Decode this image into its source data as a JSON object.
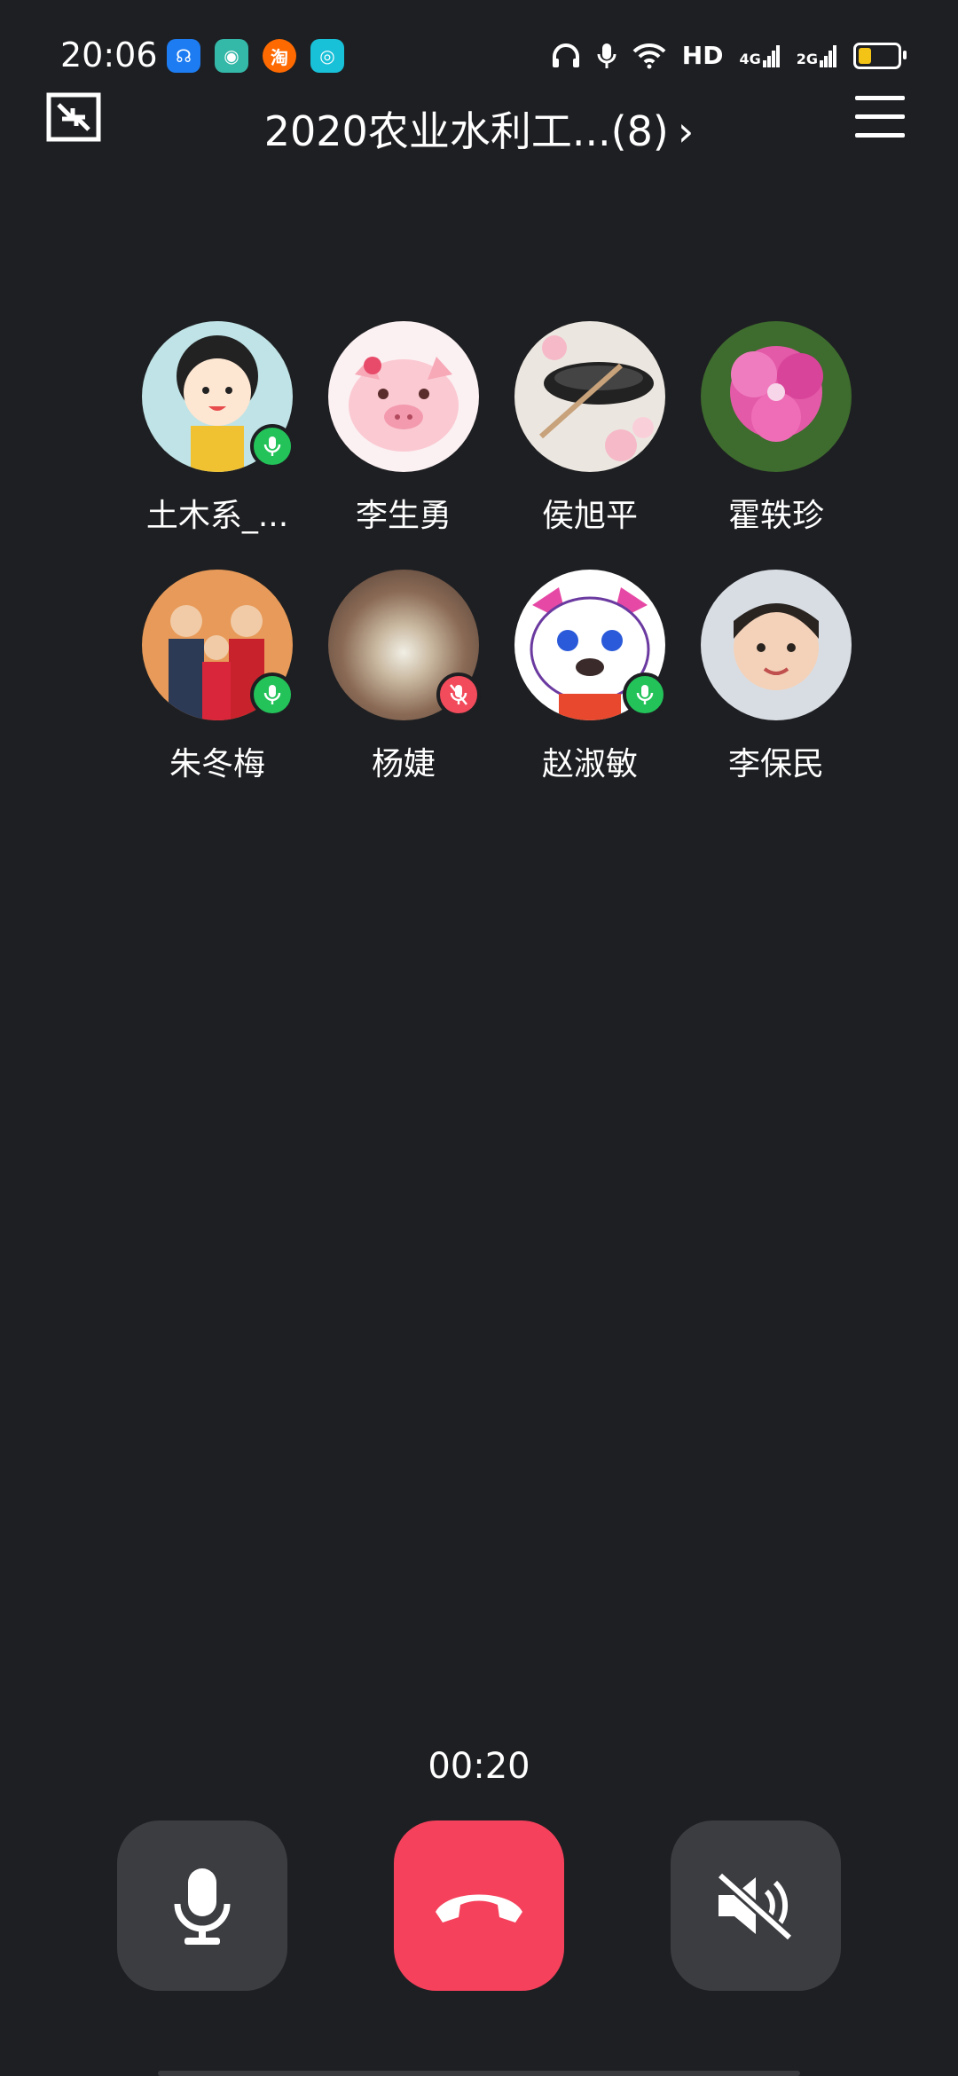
{
  "status_bar": {
    "time": "20:06",
    "notifications": [
      {
        "name": "assistant-icon",
        "color": "#1d7cf2",
        "glyph": "☊"
      },
      {
        "name": "chat-icon",
        "color": "#34b8a8",
        "glyph": "◉"
      },
      {
        "name": "taobao-icon",
        "color": "#ff6a00",
        "glyph": "淘"
      },
      {
        "name": "camera-app-icon",
        "color": "#18c0d8",
        "glyph": "◎"
      }
    ],
    "hd_label": "HD",
    "net1": "4G",
    "net2": "2G"
  },
  "header": {
    "title": "2020农业水利工...(8)",
    "chevron": "›"
  },
  "participants": [
    {
      "name": "土木系_...",
      "mic": "on",
      "avatar_bg": "#bfe3e6",
      "avatar_icon": "cartoon-girl-avatar"
    },
    {
      "name": "李生勇",
      "mic": "none",
      "avatar_bg": "#fbd3d9",
      "avatar_icon": "pig-avatar"
    },
    {
      "name": "侯旭平",
      "mic": "none",
      "avatar_bg": "#e9e4df",
      "avatar_icon": "ink-brush-avatar"
    },
    {
      "name": "霍轶珍",
      "mic": "none",
      "avatar_bg": "#e055a5",
      "avatar_icon": "flower-avatar"
    },
    {
      "name": "朱冬梅",
      "mic": "on",
      "avatar_bg": "#e79a59",
      "avatar_icon": "family-photo-avatar"
    },
    {
      "name": "杨婕",
      "mic": "off",
      "avatar_bg": "#8a6a55",
      "avatar_icon": "forest-avatar"
    },
    {
      "name": "赵淑敏",
      "mic": "on",
      "avatar_bg": "#ffffff",
      "avatar_icon": "cartoon-cat-avatar"
    },
    {
      "name": "李保民",
      "mic": "none",
      "avatar_bg": "#d8dde4",
      "avatar_icon": "boy-photo-avatar"
    }
  ],
  "call": {
    "timer": "00:20"
  },
  "colors": {
    "background": "#1e1f22",
    "mic_on": "#23c35a",
    "mic_off": "#f24b5b",
    "hangup": "#f5415c",
    "control_bg": "#3c3d41"
  }
}
